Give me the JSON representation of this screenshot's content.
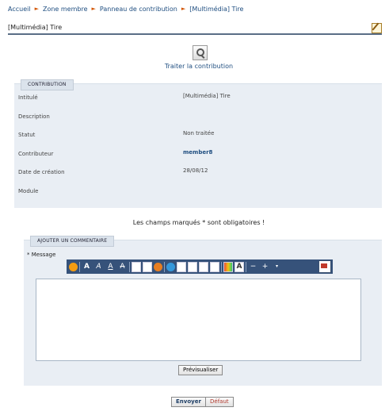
{
  "breadcrumb": {
    "items": [
      "Accueil",
      "Zone membre",
      "Panneau de contribution",
      "[Multimédia] Tire"
    ]
  },
  "page": {
    "title": "[Multimédia] Tire",
    "edit_icon": "edit-icon"
  },
  "treat": {
    "label": "Traiter la contribution",
    "icon": "magnifier-icon"
  },
  "contribution": {
    "legend": "CONTRIBUTION",
    "rows": [
      {
        "label": "Intitulé",
        "value": "[Multimédia] Tire"
      },
      {
        "label": "Description",
        "value": ""
      },
      {
        "label": "Statut",
        "value": "Non traitée"
      },
      {
        "label": "Contributeur",
        "value": "member8"
      },
      {
        "label": "Date de création",
        "value": "28/08/12"
      },
      {
        "label": "Module",
        "value": ""
      }
    ]
  },
  "required_note": "Les champs marqués * sont obligatoires !",
  "comment": {
    "legend": "AJOUTER UN COMMENTAIRE",
    "message_label": "* Message",
    "message_value": "",
    "preview_label": "Prévisualiser"
  },
  "actions": {
    "send_label": "Envoyer",
    "reset_label": "Défaut"
  },
  "colors": {
    "accent": "#1f4e80",
    "toolbar": "#36527a",
    "panel": "#e9eef4",
    "crumb_arrow": "#d35400"
  }
}
